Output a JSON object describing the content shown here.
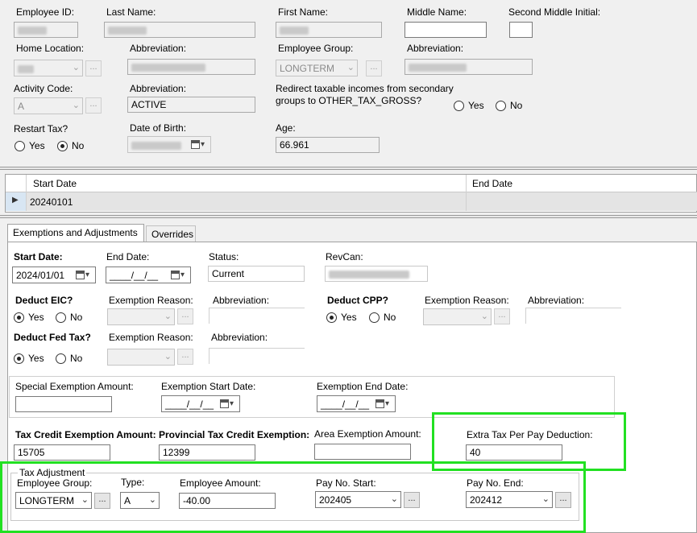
{
  "header": {
    "employee_id_label": "Employee ID:",
    "last_name_label": "Last Name:",
    "first_name_label": "First Name:",
    "middle_name_label": "Middle Name:",
    "second_middle_initial_label": "Second Middle Initial:",
    "home_location_label": "Home Location:",
    "abbreviation_label": "Abbreviation:",
    "employee_group_label": "Employee Group:",
    "employee_group_value": "LONGTERM",
    "activity_code_label": "Activity Code:",
    "activity_code_value": "A",
    "activity_abbreviation_value": "ACTIVE",
    "redirect_label_line1": "Redirect taxable incomes from secondary",
    "redirect_label_line2": "groups to OTHER_TAX_GROSS?",
    "yes": "Yes",
    "no": "No",
    "restart_tax_label": "Restart Tax?",
    "date_of_birth_label": "Date of Birth:",
    "age_label": "Age:",
    "age_value": "66.961",
    "ellipsis": "..."
  },
  "grid": {
    "col_start": "Start Date",
    "col_end": "End Date",
    "rows": [
      {
        "start": "20240101",
        "end": ""
      }
    ]
  },
  "tabs": [
    "Exemptions and Adjustments",
    "Overrides"
  ],
  "exemptions": {
    "start_date_label": "Start Date:",
    "start_date_value": "2024/01/01",
    "end_date_label": "End Date:",
    "end_date_value": "____/__/__",
    "status_label": "Status:",
    "status_value": "Current",
    "revcan_label": "RevCan:",
    "deduct_eic_label": "Deduct EIC?",
    "exemption_reason_label": "Exemption Reason:",
    "abbreviation_label": "Abbreviation:",
    "deduct_cpp_label": "Deduct CPP?",
    "deduct_fed_tax_label": "Deduct Fed Tax?",
    "special_exemption_label": "Special Exemption Amount:",
    "exemption_start_label": "Exemption Start Date:",
    "exemption_end_label": "Exemption End Date:",
    "blank_date": "____/__/__",
    "tax_credit_label": "Tax Credit Exemption Amount:",
    "tax_credit_value": "15705",
    "prov_tax_credit_label": "Provincial Tax Credit Exemption:",
    "prov_tax_credit_value": "12399",
    "area_exemption_label": "Area Exemption Amount:",
    "extra_tax_label": "Extra Tax Per Pay Deduction:",
    "extra_tax_value": "40"
  },
  "tax_adjustment": {
    "legend": "Tax Adjustment",
    "employee_group_label": "Employee Group:",
    "employee_group_value": "LONGTERM",
    "type_label": "Type:",
    "type_value": "A",
    "employee_amount_label": "Employee Amount:",
    "employee_amount_value": "-40.00",
    "pay_start_label": "Pay No. Start:",
    "pay_start_value": "202405",
    "pay_end_label": "Pay No. End:",
    "pay_end_value": "202412"
  },
  "colors": {
    "highlight": "#22e022",
    "selected_row": "#cce4f7"
  }
}
